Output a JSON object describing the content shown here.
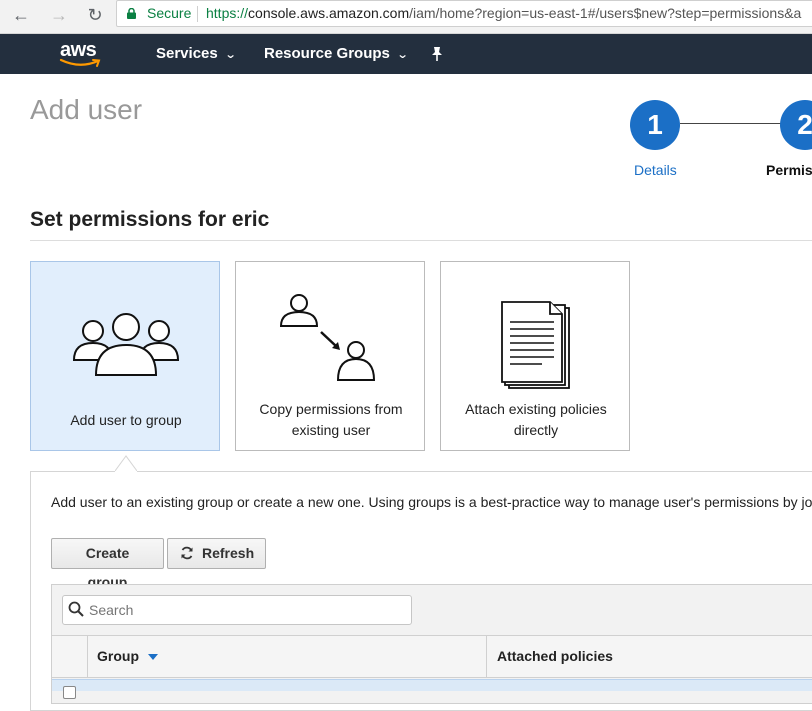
{
  "browser": {
    "secure_label": "Secure",
    "url_scheme": "https://",
    "url_host": "console.aws.amazon.com",
    "url_path": "/iam/home?region=us-east-1#/users$new?step=permissions&a"
  },
  "nav": {
    "logo_text": "aws",
    "services_label": "Services",
    "resource_groups_label": "Resource Groups"
  },
  "header": {
    "title": "Add user",
    "steps": [
      {
        "number": "1",
        "label": "Details"
      },
      {
        "number": "2",
        "label": "Permiss"
      }
    ]
  },
  "permissions": {
    "section_title": "Set permissions for eric",
    "options": [
      {
        "label": "Add user to group",
        "icon": "group-icon",
        "selected": true
      },
      {
        "label": "Copy permissions from existing user",
        "icon": "copy-user-icon",
        "selected": false
      },
      {
        "label": "Attach existing policies directly",
        "icon": "document-icon",
        "selected": false
      }
    ],
    "description": "Add user to an existing group or create a new one. Using groups is a best-practice way to manage user's permissions by job f",
    "create_group_label": "Create group",
    "refresh_label": "Refresh",
    "search_placeholder": "Search",
    "columns": [
      "Group",
      "Attached policies"
    ]
  },
  "colors": {
    "nav_bg": "#232f3e",
    "accent": "#1b6fc6",
    "selected_card": "#e1eefc"
  }
}
